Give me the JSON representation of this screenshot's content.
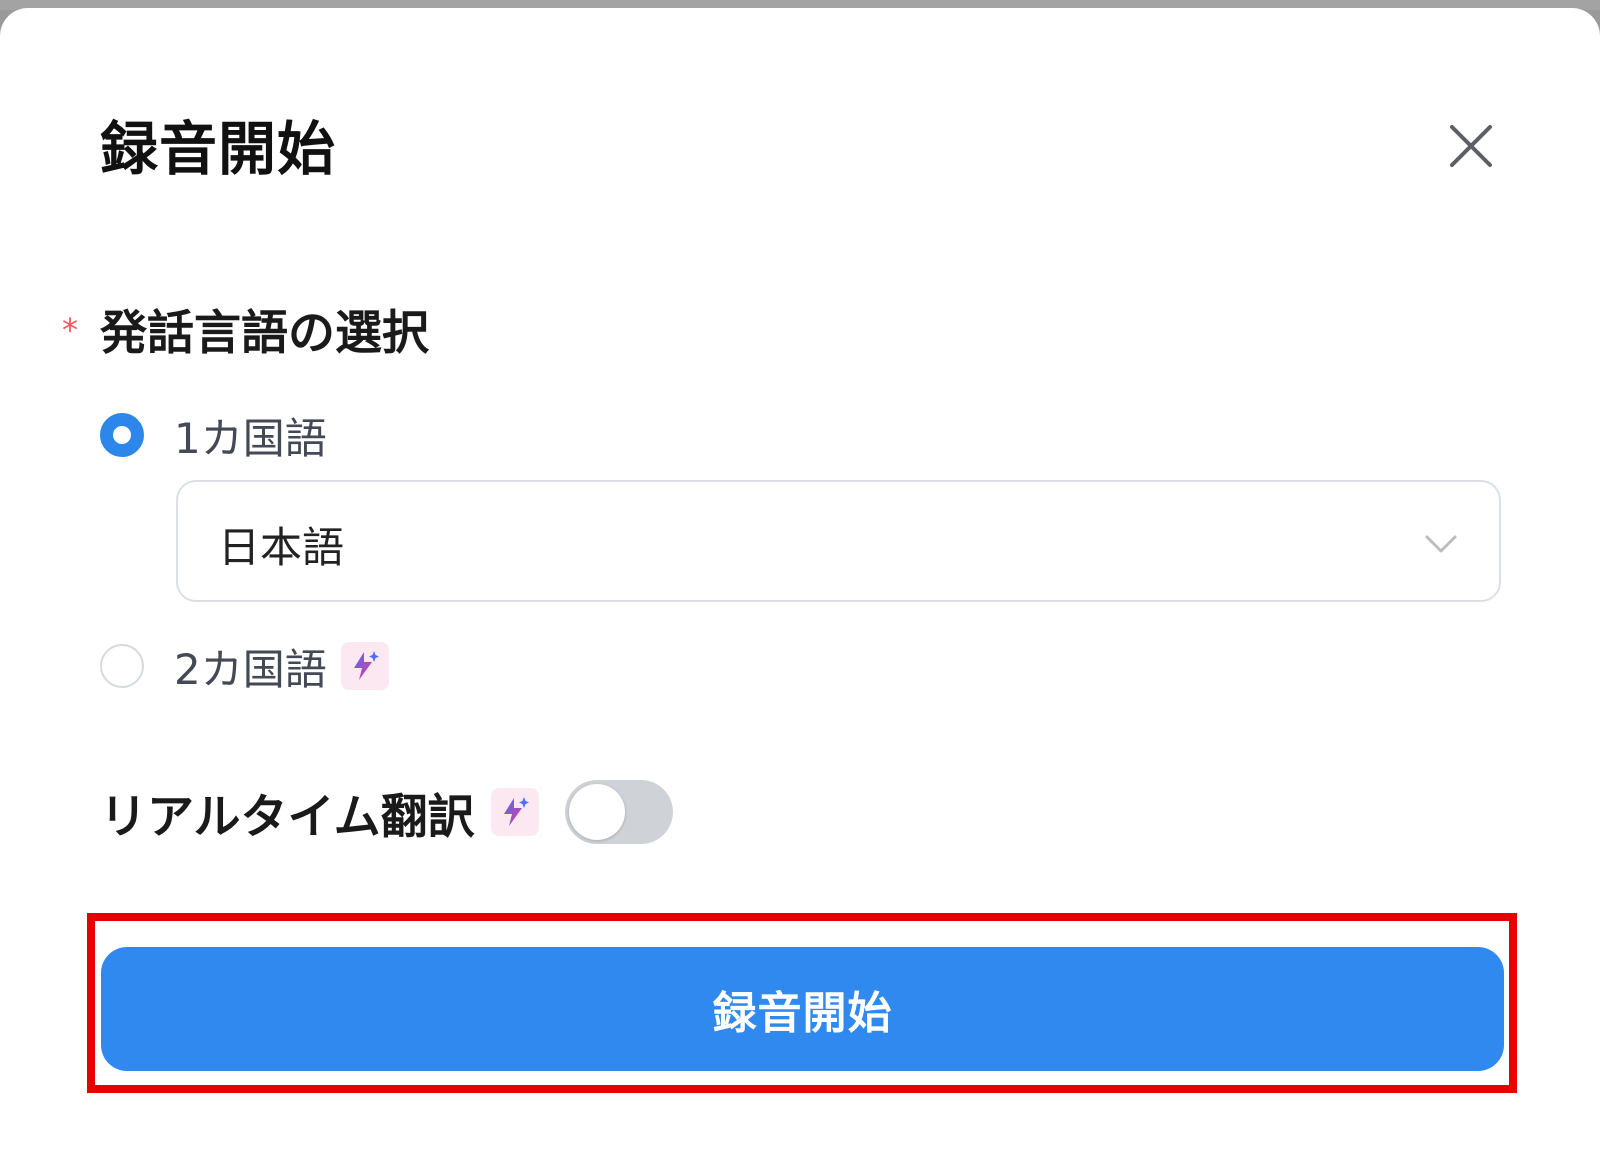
{
  "dialog": {
    "title": "録音開始",
    "close_icon": "close-icon"
  },
  "language_field": {
    "required_mark": "*",
    "label": "発話言語の選択",
    "options": [
      {
        "label": "1カ国語",
        "selected": true
      },
      {
        "label": "2カ国語",
        "selected": false,
        "badge_icon": "ai-sparkle-icon"
      }
    ],
    "select": {
      "value": "日本語",
      "caret_icon": "chevron-down-icon"
    }
  },
  "realtime_translation": {
    "label": "リアルタイム翻訳",
    "badge_icon": "ai-sparkle-icon",
    "enabled": false
  },
  "start_button": {
    "label": "録音開始"
  },
  "colors": {
    "accent": "#2f89ee",
    "required": "#f0595c",
    "highlight": "#e60000",
    "toggle_off": "#cfd3d8"
  }
}
